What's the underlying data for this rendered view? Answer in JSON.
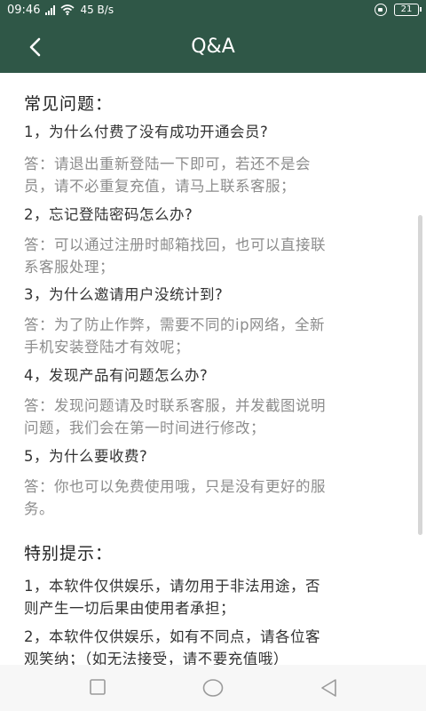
{
  "status": {
    "time": "09:46",
    "speed": "45 B/s",
    "battery": "21"
  },
  "header": {
    "title": "Q&A"
  },
  "faq": {
    "title": "常见问题：",
    "items": [
      {
        "q": "1，为什么付费了没有成功开通会员?",
        "a_line1": "答：请退出重新登陆一下即可，若还不是会",
        "a_line2": "员，请不必重复充值，请马上联系客服；"
      },
      {
        "q": "2，忘记登陆密码怎么办?",
        "a_line1": "答：可以通过注册时邮箱找回，也可以直接联",
        "a_line2": "系客服处理；"
      },
      {
        "q": "3，为什么邀请用户没统计到?",
        "a_line1": "答：为了防止作弊，需要不同的ip网络，全新",
        "a_line2": "手机安装登陆才有效呢；"
      },
      {
        "q": "4，发现产品有问题怎么办?",
        "a_line1": "答：发现问题请及时联系客服，并发截图说明",
        "a_line2": "问题，我们会在第一时间进行修改；"
      },
      {
        "q": "5，为什么要收费?",
        "a_line1": "答：你也可以免费使用哦，只是没有更好的服",
        "a_line2": "务。"
      }
    ]
  },
  "notice": {
    "title": "特别提示：",
    "items": [
      {
        "line1": "1，本软件仅供娱乐，请勿用于非法用途，否",
        "line2": "则产生一切后果由使用者承担；"
      },
      {
        "line1": "2，本软件仅供娱乐，如有不同点，请各位客",
        "line2": "观笑纳；（如无法接受，请不要充值哦）"
      }
    ]
  },
  "icons": {
    "back": "chevron-left-icon",
    "nav_recent": "square-icon",
    "nav_home": "circle-icon",
    "nav_back": "triangle-icon"
  },
  "colors": {
    "primary": "#2f5747",
    "answer_text": "#8c8c8c"
  }
}
